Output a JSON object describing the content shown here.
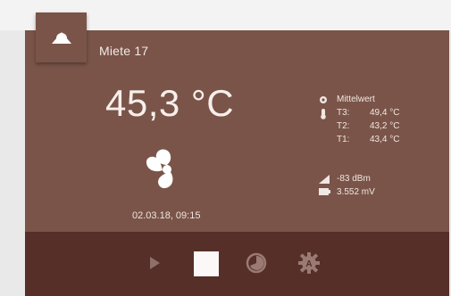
{
  "device": {
    "name": "Miete 17",
    "temperature": "45,3 °C",
    "timestamp": "02.03.18, 09:15"
  },
  "sensors": {
    "mode_label": "Mittelwert",
    "readings": [
      {
        "label": "T3:",
        "value": "49,4 °C"
      },
      {
        "label": "T2:",
        "value": "43,2 °C"
      },
      {
        "label": "T1:",
        "value": "43,4 °C"
      }
    ]
  },
  "status": {
    "signal": "-83 dBm",
    "battery": "3.552 mV"
  },
  "colors": {
    "card": "#7a5448",
    "footer": "#552f28",
    "text": "#f6efec"
  },
  "icons": {
    "device": "cloud-icon",
    "fan": "fan-icon",
    "mode": "circle-dot-icon",
    "thermometer": "thermometer-icon",
    "signal": "signal-icon",
    "battery": "battery-icon",
    "play": "play-icon",
    "stop": "stop-icon",
    "history": "history-icon",
    "settings": "gear-icon"
  }
}
